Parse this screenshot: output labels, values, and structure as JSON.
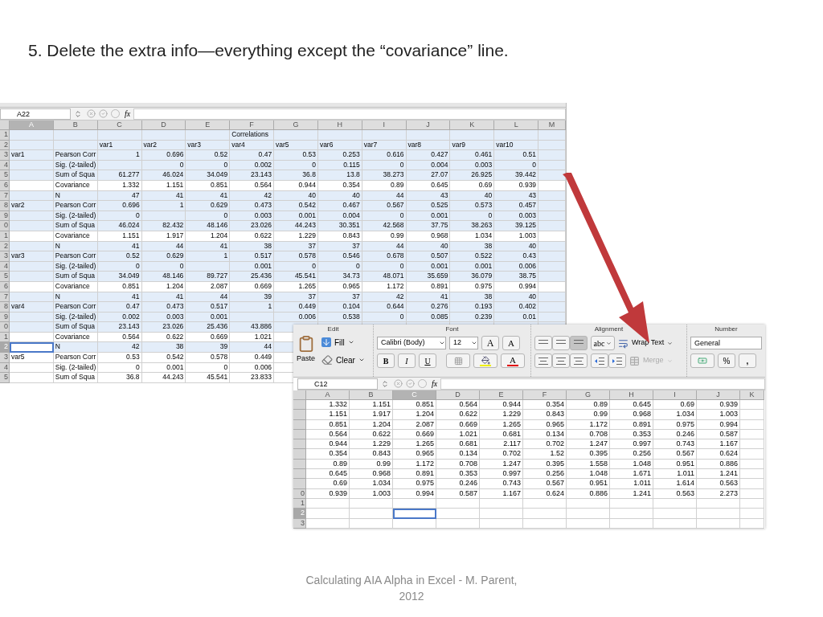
{
  "slide": {
    "title": "5. Delete the extra info—everything except the “covariance” line.",
    "footer": [
      "Calculating AIA Alpha in Excel - M. Parent,",
      "2012"
    ]
  },
  "back_sheet": {
    "name_box": "A22",
    "fx": "fx",
    "columns": [
      {
        "label": "A",
        "selected": true
      },
      {
        "label": "B",
        "selected": false
      },
      {
        "label": "C",
        "selected": false
      },
      {
        "label": "D",
        "selected": false
      },
      {
        "label": "E",
        "selected": false
      },
      {
        "label": "F",
        "selected": false
      },
      {
        "label": "G",
        "selected": false
      },
      {
        "label": "H",
        "selected": false
      },
      {
        "label": "I",
        "selected": false
      },
      {
        "label": "J",
        "selected": false
      },
      {
        "label": "K",
        "selected": false
      },
      {
        "label": "L",
        "selected": false
      },
      {
        "label": "M",
        "selected": false
      }
    ],
    "rows": [
      {
        "header": "1",
        "highlighted": true,
        "selected": false,
        "cells": [
          null,
          null,
          null,
          null,
          null,
          "Correlations"
        ]
      },
      {
        "header": "2",
        "highlighted": true,
        "selected": false,
        "cells": [
          null,
          null,
          "var1",
          "var2",
          "var3",
          "var4",
          "var5",
          "var6",
          "var7",
          "var8",
          "var9",
          "var10"
        ]
      },
      {
        "header": "3",
        "highlighted": true,
        "selected": false,
        "cells": [
          "var1",
          "Pearson Corr",
          "1",
          "0.696",
          "0.52",
          "0.47",
          "0.53",
          "0.253",
          "0.616",
          "0.427",
          "0.461",
          "0.51"
        ]
      },
      {
        "header": "4",
        "highlighted": true,
        "selected": false,
        "cells": [
          null,
          "Sig. (2-tailed)",
          null,
          "0",
          "0",
          "0.002",
          "0",
          "0.115",
          "0",
          "0.004",
          "0.003",
          "0"
        ]
      },
      {
        "header": "5",
        "highlighted": true,
        "selected": false,
        "cells": [
          null,
          "Sum of Squa",
          "61.277",
          "46.024",
          "34.049",
          "23.143",
          "36.8",
          "13.8",
          "38.273",
          "27.07",
          "26.925",
          "39.442"
        ]
      },
      {
        "header": "6",
        "highlighted": false,
        "selected": false,
        "cells": [
          null,
          "Covariance",
          "1.332",
          "1.151",
          "0.851",
          "0.564",
          "0.944",
          "0.354",
          "0.89",
          "0.645",
          "0.69",
          "0.939"
        ]
      },
      {
        "header": "7",
        "highlighted": true,
        "selected": false,
        "cells": [
          null,
          "N",
          "47",
          "41",
          "41",
          "42",
          "40",
          "40",
          "44",
          "43",
          "40",
          "43"
        ]
      },
      {
        "header": "8",
        "highlighted": true,
        "selected": false,
        "cells": [
          "var2",
          "Pearson Corr",
          "0.696",
          "1",
          "0.629",
          "0.473",
          "0.542",
          "0.467",
          "0.567",
          "0.525",
          "0.573",
          "0.457"
        ]
      },
      {
        "header": "9",
        "highlighted": true,
        "selected": false,
        "cells": [
          null,
          "Sig. (2-tailed)",
          "0",
          null,
          "0",
          "0.003",
          "0.001",
          "0.004",
          "0",
          "0.001",
          "0",
          "0.003"
        ]
      },
      {
        "header": "0",
        "highlighted": true,
        "selected": false,
        "cells": [
          null,
          "Sum of Squa",
          "46.024",
          "82.432",
          "48.146",
          "23.026",
          "44.243",
          "30.351",
          "42.568",
          "37.75",
          "38.263",
          "39.125"
        ]
      },
      {
        "header": "1",
        "highlighted": false,
        "selected": false,
        "cells": [
          null,
          "Covariance",
          "1.151",
          "1.917",
          "1.204",
          "0.622",
          "1.229",
          "0.843",
          "0.99",
          "0.968",
          "1.034",
          "1.003"
        ]
      },
      {
        "header": "2",
        "highlighted": true,
        "selected": false,
        "cells": [
          null,
          "N",
          "41",
          "44",
          "41",
          "38",
          "37",
          "37",
          "44",
          "40",
          "38",
          "40"
        ]
      },
      {
        "header": "3",
        "highlighted": true,
        "selected": false,
        "cells": [
          "var3",
          "Pearson Corr",
          "0.52",
          "0.629",
          "1",
          "0.517",
          "0.578",
          "0.546",
          "0.678",
          "0.507",
          "0.522",
          "0.43"
        ]
      },
      {
        "header": "4",
        "highlighted": true,
        "selected": false,
        "cells": [
          null,
          "Sig. (2-tailed)",
          "0",
          "0",
          null,
          "0.001",
          "0",
          "0",
          "0",
          "0.001",
          "0.001",
          "0.006"
        ]
      },
      {
        "header": "5",
        "highlighted": true,
        "selected": false,
        "cells": [
          null,
          "Sum of Squa",
          "34.049",
          "48.146",
          "89.727",
          "25.436",
          "45.541",
          "34.73",
          "48.071",
          "35.659",
          "36.079",
          "38.75"
        ]
      },
      {
        "header": "6",
        "highlighted": false,
        "selected": false,
        "cells": [
          null,
          "Covariance",
          "0.851",
          "1.204",
          "2.087",
          "0.669",
          "1.265",
          "0.965",
          "1.172",
          "0.891",
          "0.975",
          "0.994"
        ]
      },
      {
        "header": "7",
        "highlighted": true,
        "selected": false,
        "cells": [
          null,
          "N",
          "41",
          "41",
          "44",
          "39",
          "37",
          "37",
          "42",
          "41",
          "38",
          "40"
        ]
      },
      {
        "header": "8",
        "highlighted": true,
        "selected": false,
        "cells": [
          "var4",
          "Pearson Corr",
          "0.47",
          "0.473",
          "0.517",
          "1",
          "0.449",
          "0.104",
          "0.644",
          "0.276",
          "0.193",
          "0.402"
        ]
      },
      {
        "header": "9",
        "highlighted": true,
        "selected": false,
        "cells": [
          null,
          "Sig. (2-tailed)",
          "0.002",
          "0.003",
          "0.001",
          null,
          "0.006",
          "0.538",
          "0",
          "0.085",
          "0.239",
          "0.01"
        ]
      },
      {
        "header": "0",
        "highlighted": true,
        "selected": false,
        "cells": [
          null,
          "Sum of Squa",
          "23.143",
          "23.026",
          "25.436",
          "43.886"
        ]
      },
      {
        "header": "1",
        "highlighted": false,
        "selected": false,
        "cells": [
          null,
          "Covariance",
          "0.564",
          "0.622",
          "0.669",
          "1.021"
        ]
      },
      {
        "header": "2",
        "highlighted": true,
        "selected": true,
        "cells": [
          null,
          "N",
          "42",
          "38",
          "39",
          "44"
        ]
      },
      {
        "header": "3",
        "highlighted": false,
        "selected": false,
        "cells": [
          "var5",
          "Pearson Corr",
          "0.53",
          "0.542",
          "0.578",
          "0.449"
        ]
      },
      {
        "header": "4",
        "highlighted": false,
        "selected": false,
        "cells": [
          null,
          "Sig. (2-tailed)",
          "0",
          "0.001",
          "0",
          "0.006"
        ]
      },
      {
        "header": "5",
        "highlighted": false,
        "selected": false,
        "cells": [
          null,
          "Sum of Squa",
          "36.8",
          "44.243",
          "45.541",
          "23.833"
        ]
      }
    ]
  },
  "front_sheet": {
    "ribbon": {
      "groups": [
        "Edit",
        "Font",
        "Alignment",
        "Number"
      ],
      "paste": "Paste",
      "fill": "Fill",
      "clear": "Clear",
      "font_name": "Calibri (Body)",
      "font_size": "12",
      "grow_font": "A",
      "shrink_font": "A",
      "bold": "B",
      "italic": "I",
      "underline": "U",
      "font_color": "A",
      "vertical_align": [
        {
          "selected": false
        },
        {
          "selected": false
        },
        {
          "selected": true
        }
      ],
      "orientation": "abc",
      "wrap_text": "Wrap Text",
      "merge": {
        "label": "Merge",
        "disabled": true
      },
      "number_format": "General",
      "percent": "%",
      "comma": ","
    },
    "name_box": "C12",
    "fx": "fx",
    "columns": [
      {
        "label": "A",
        "selected": false
      },
      {
        "label": "B",
        "selected": false
      },
      {
        "label": "C",
        "selected": true
      },
      {
        "label": "D",
        "selected": false
      },
      {
        "label": "E",
        "selected": false
      },
      {
        "label": "F",
        "selected": false
      },
      {
        "label": "G",
        "selected": false
      },
      {
        "label": "H",
        "selected": false
      },
      {
        "label": "I",
        "selected": false
      },
      {
        "label": "J",
        "selected": false
      },
      {
        "label": "K",
        "selected": false
      }
    ],
    "rows": [
      {
        "selected": false,
        "cells": [
          "1.332",
          "1.151",
          "0.851",
          "0.564",
          "0.944",
          "0.354",
          "0.89",
          "0.645",
          "0.69",
          "0.939"
        ]
      },
      {
        "selected": false,
        "cells": [
          "1.151",
          "1.917",
          "1.204",
          "0.622",
          "1.229",
          "0.843",
          "0.99",
          "0.968",
          "1.034",
          "1.003"
        ]
      },
      {
        "selected": false,
        "cells": [
          "0.851",
          "1.204",
          "2.087",
          "0.669",
          "1.265",
          "0.965",
          "1.172",
          "0.891",
          "0.975",
          "0.994"
        ]
      },
      {
        "selected": false,
        "cells": [
          "0.564",
          "0.622",
          "0.669",
          "1.021",
          "0.681",
          "0.134",
          "0.708",
          "0.353",
          "0.246",
          "0.587"
        ]
      },
      {
        "selected": false,
        "cells": [
          "0.944",
          "1.229",
          "1.265",
          "0.681",
          "2.117",
          "0.702",
          "1.247",
          "0.997",
          "0.743",
          "1.167"
        ]
      },
      {
        "selected": false,
        "cells": [
          "0.354",
          "0.843",
          "0.965",
          "0.134",
          "0.702",
          "1.52",
          "0.395",
          "0.256",
          "0.567",
          "0.624"
        ]
      },
      {
        "selected": false,
        "cells": [
          "0.89",
          "0.99",
          "1.172",
          "0.708",
          "1.247",
          "0.395",
          "1.558",
          "1.048",
          "0.951",
          "0.886"
        ]
      },
      {
        "selected": false,
        "cells": [
          "0.645",
          "0.968",
          "0.891",
          "0.353",
          "0.997",
          "0.256",
          "1.048",
          "1.671",
          "1.011",
          "1.241"
        ]
      },
      {
        "selected": false,
        "cells": [
          "0.69",
          "1.034",
          "0.975",
          "0.246",
          "0.743",
          "0.567",
          "0.951",
          "1.011",
          "1.614",
          "0.563"
        ]
      },
      {
        "header": "0",
        "selected": false,
        "cells": [
          "0.939",
          "1.003",
          "0.994",
          "0.587",
          "1.167",
          "0.624",
          "0.886",
          "1.241",
          "0.563",
          "2.273"
        ]
      },
      {
        "header": "1",
        "selected": false,
        "cells": []
      },
      {
        "header": "2",
        "selected": true,
        "cells": []
      },
      {
        "header": "3",
        "selected": false,
        "cells": []
      }
    ]
  }
}
